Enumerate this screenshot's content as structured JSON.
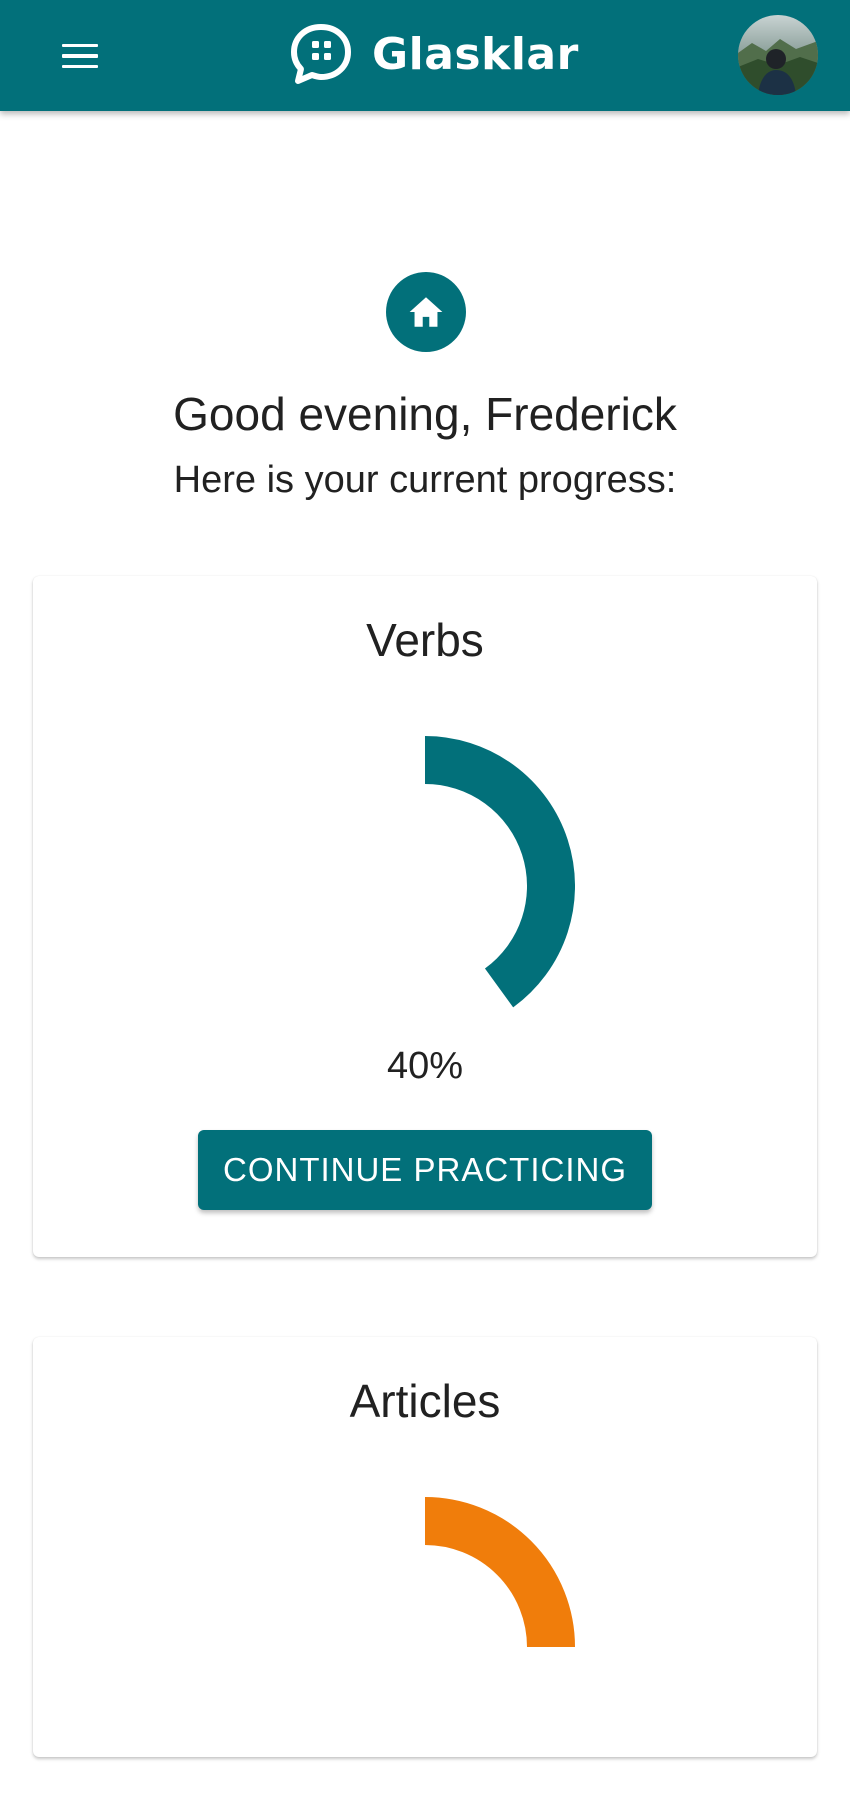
{
  "header": {
    "app_name": "Glasklar",
    "menu_icon": "hamburger-menu-icon",
    "logo_icon": "chat-bubble-logo-icon",
    "avatar": "user-avatar-photo"
  },
  "colors": {
    "primary": "#02707a",
    "articles_accent": "#f07d0b",
    "text": "#212121"
  },
  "home": {
    "icon": "home-icon",
    "greeting": "Good evening, Frederick",
    "subtitle": "Here is your current progress:"
  },
  "progress_cards": [
    {
      "title": "Verbs",
      "progress": 0.4,
      "percent_label": "40%",
      "button_label": "CONTINUE PRACTICING",
      "color": "#02707a"
    },
    {
      "title": "Articles",
      "progress": 0.25,
      "color": "#f07d0b"
    }
  ]
}
